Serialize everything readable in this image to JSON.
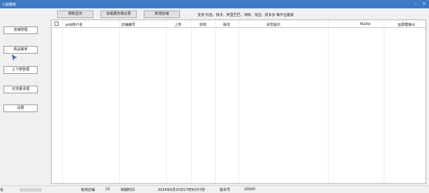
{
  "window": {
    "title": "小鼠都家",
    "minimize": "–",
    "close": "×"
  },
  "toolbar": {
    "refresh_label": "刷新显示",
    "service_log_label": "加载服务端记录",
    "add_shop_label": "新增店铺",
    "platforms_text": "支持 抖音，快手，阿里巴巴，淘特，淘宝，拼多多 等平台搬家"
  },
  "sidebar": {
    "items": [
      {
        "label": "店铺管理"
      },
      {
        "label": "商品搬家"
      },
      {
        "label": "上下架管理"
      },
      {
        "label": "无流量清理"
      },
      {
        "label": "设置"
      }
    ]
  },
  "table": {
    "columns": [
      "pdd账户名",
      "店铺编号",
      "上传",
      "授权",
      "版本",
      "状态提示",
      "MallId",
      "运费模板id"
    ],
    "rows": []
  },
  "status": {
    "name_label": "名",
    "valid_shops_label": "有效店铺",
    "valid_shops_value": "23",
    "expire_label": "到期时间",
    "expire_value": "2024年6月20日17时9分57秒",
    "version_label": "版本号",
    "version_value": "10000"
  },
  "colors": {
    "titlebar": "#3f79c4",
    "cursor": "#3d6fb5"
  }
}
